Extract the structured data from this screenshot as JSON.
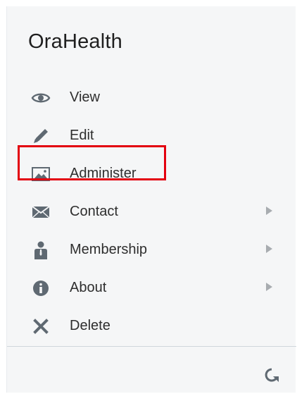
{
  "menu": {
    "title": "OraHealth",
    "items": [
      {
        "label": "View",
        "icon": "eye-icon",
        "has_submenu": false
      },
      {
        "label": "Edit",
        "icon": "pencil-icon",
        "has_submenu": false
      },
      {
        "label": "Administer",
        "icon": "image-icon",
        "has_submenu": false,
        "highlighted": true
      },
      {
        "label": "Contact",
        "icon": "envelope-icon",
        "has_submenu": true
      },
      {
        "label": "Membership",
        "icon": "person-icon",
        "has_submenu": true
      },
      {
        "label": "About",
        "icon": "info-icon",
        "has_submenu": true
      },
      {
        "label": "Delete",
        "icon": "close-icon",
        "has_submenu": false
      }
    ],
    "footer": {
      "icon": "refresh-icon"
    }
  },
  "colors": {
    "panel_bg": "#f5f6f7",
    "icon": "#5f6972",
    "highlight_border": "#e3000f",
    "submenu_arrow": "#a8acb0"
  }
}
